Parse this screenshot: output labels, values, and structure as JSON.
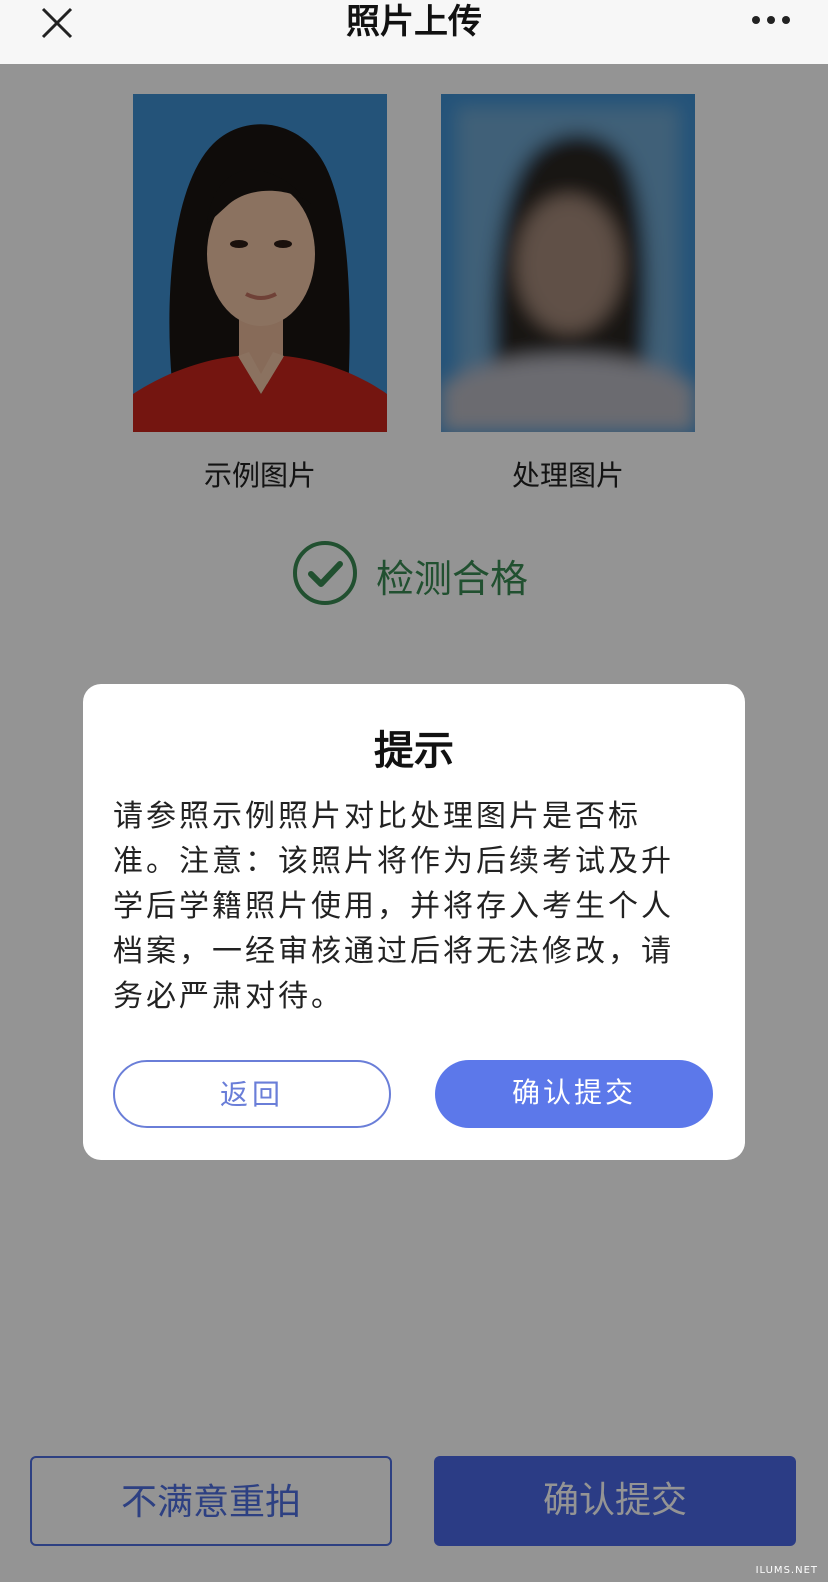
{
  "nav": {
    "title": "照片上传",
    "close_icon": "close-icon",
    "more_icon": "more-icon"
  },
  "photos": {
    "sample_caption": "示例图片",
    "processed_caption": "处理图片"
  },
  "check": {
    "label": "检测合格",
    "icon": "check-circle-icon",
    "color": "#3a8a53"
  },
  "dialog": {
    "title": "提示",
    "body": "请参照示例照片对比处理图片是否标准。注意：该照片将作为后续考试及升学后学籍照片使用，并将存入考生个人档案，一经审核通过后将无法修改，请务必严肃对待。",
    "back_label": "返回",
    "confirm_label": "确认提交"
  },
  "bottom": {
    "retake_label": "不满意重拍",
    "submit_label": "确认提交"
  },
  "watermark": "ILUMS.NET",
  "colors": {
    "accent": "#4a68e6",
    "photo_background": "#3e8fd0",
    "success": "#3a8a53"
  }
}
